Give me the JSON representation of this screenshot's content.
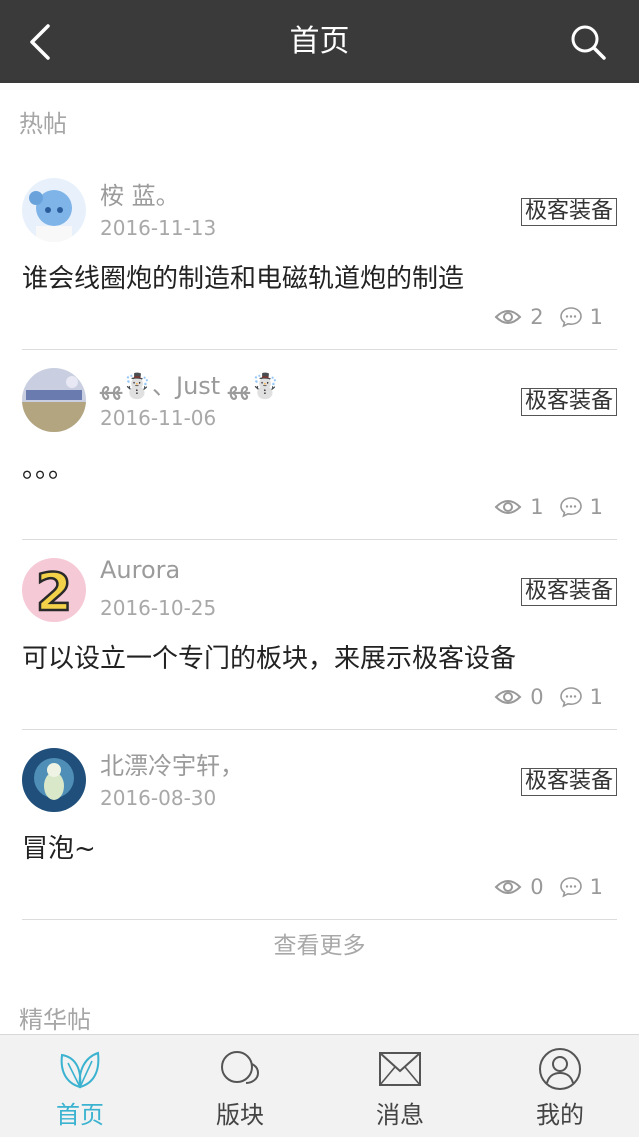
{
  "header": {
    "title": "首页"
  },
  "sections": {
    "hot": "热帖",
    "featured": "精华帖"
  },
  "posts": [
    {
      "username": "桉 蓝。",
      "date": "2016-11-13",
      "tag": "极客装备",
      "title": "谁会线圈炮的制造和电磁轨道炮的制造",
      "views": "2",
      "comments": "1"
    },
    {
      "username": "ﻬﻬ☃️、Just ﻬﻬ☃️",
      "date": "2016-11-06",
      "tag": "极客装备",
      "title": "。。。",
      "views": "1",
      "comments": "1"
    },
    {
      "username": "Aurora",
      "date": "2016-10-25",
      "tag": "极客装备",
      "title": "可以设立一个专门的板块，来展示极客设备",
      "views": "0",
      "comments": "1"
    },
    {
      "username": "北漂冷宇轩，",
      "date": "2016-08-30",
      "tag": "极客装备",
      "title": "冒泡~",
      "views": "0",
      "comments": "1"
    }
  ],
  "more_label": "查看更多",
  "tabs": [
    {
      "label": "首页",
      "icon": "leaf-icon"
    },
    {
      "label": "版块",
      "icon": "bubbles-icon"
    },
    {
      "label": "消息",
      "icon": "envelope-icon"
    },
    {
      "label": "我的",
      "icon": "user-icon"
    }
  ],
  "colors": {
    "header_bg": "#3b3a3a",
    "accent": "#3bb3d0",
    "tabbar_bg": "#f2f2f2"
  }
}
